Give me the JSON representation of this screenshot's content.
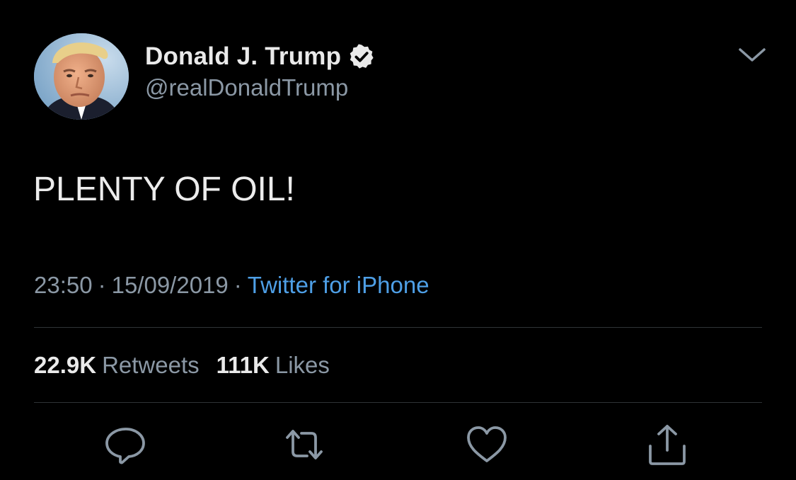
{
  "author": {
    "display_name": "Donald J. Trump",
    "handle": "@realDonaldTrump",
    "verified": true,
    "avatar_icon": "profile-photo"
  },
  "tweet": {
    "text": "PLENTY OF OIL!",
    "time": "23:50",
    "separator": "·",
    "date": "15/09/2019",
    "source": "Twitter for iPhone"
  },
  "stats": {
    "retweets_count": "22.9K",
    "retweets_label": "Retweets",
    "likes_count": "111K",
    "likes_label": "Likes"
  },
  "actions": [
    {
      "icon": "reply-icon"
    },
    {
      "icon": "retweet-icon"
    },
    {
      "icon": "like-icon"
    },
    {
      "icon": "share-icon"
    }
  ],
  "colors": {
    "background": "#000000",
    "primary_text": "#eaeaea",
    "secondary_text": "#8b98a5",
    "link": "#4e9fe6",
    "divider": "#2f3336"
  }
}
